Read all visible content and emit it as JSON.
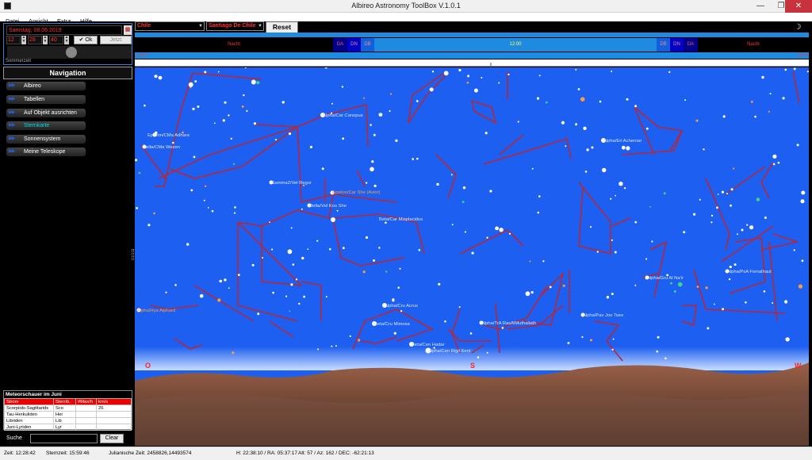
{
  "window": {
    "title": "Albireo Astronomy ToolBox V.1.0.1",
    "minimize": "—",
    "maximize": "❐",
    "close": "✕"
  },
  "menu": [
    "Datei",
    "Ansicht",
    "Extra",
    "Hilfe"
  ],
  "datetime": {
    "date": "Samstag, 08.06.2019",
    "hour": "12",
    "minute": "28",
    "second": "40",
    "ok_label": "✔ Ok",
    "now_label": "Jetzt",
    "dst_label": "Sommerzeit"
  },
  "location": {
    "country": "Chile",
    "city": "Santiago De Chile",
    "reset_label": "Reset"
  },
  "timeline": {
    "nacht_left": "Nacht",
    "da": "DA",
    "dn": "DN",
    "db": "DB",
    "noon": "12:00",
    "nacht_right": "Nacht",
    "scale_left": "19:54",
    "scale_right": "19:54"
  },
  "navigation": {
    "title": "Navigation",
    "items": [
      {
        "label": "Albireo",
        "active": false
      },
      {
        "label": "Tabellen",
        "active": false
      },
      {
        "label": "Auf Objekt ausrichten",
        "active": false
      },
      {
        "label": "Sternkarte",
        "active": true
      },
      {
        "label": "Sonnensystem",
        "active": false
      },
      {
        "label": "Meine Teleskope",
        "active": false
      }
    ]
  },
  "meteors": {
    "title": "Meteorschauer im Juni",
    "headers": [
      "Strom",
      "Sternb.",
      "#Max/h",
      "km/s"
    ],
    "rows": [
      [
        "Scorpiids-Sagittarids",
        "Sco",
        "",
        "26"
      ],
      [
        "Tau-Herkuliden",
        "Her",
        "",
        ""
      ],
      [
        "Libriden",
        "Lib",
        "",
        ""
      ],
      [
        "Juni-Lyriden",
        "Lyr",
        "",
        ""
      ]
    ]
  },
  "search": {
    "label": "Suche",
    "clear_label": "Clear"
  },
  "compass": {
    "east": "O",
    "south": "S",
    "west": "W"
  },
  "stars": [
    {
      "name": "Alpha/Car Canopus"
    },
    {
      "name": "Epsilon/CMa Adhara"
    },
    {
      "name": "Delta/CMa Wezen"
    },
    {
      "name": "Gamma2/Vel Regor"
    },
    {
      "name": "Epsilon/Car She (Avior)"
    },
    {
      "name": "Delta/Vel Koo She"
    },
    {
      "name": "Beta/Car Miaplacidus"
    },
    {
      "name": "Alpha/Eri Achernar"
    },
    {
      "name": "Alpha/Gru Al Na'ir"
    },
    {
      "name": "Alpha/PsA Fomalhaut"
    },
    {
      "name": "Alpha/Pav Joo Tseo"
    },
    {
      "name": "Alpha/TrA RasAlMuthallath"
    },
    {
      "name": "Alpha/Cru Acrux"
    },
    {
      "name": "Beta/Cru Mimosa"
    },
    {
      "name": "Beta/Cen Hadar"
    },
    {
      "name": "Alpha/Cen Rigil Kent"
    },
    {
      "name": "Alpha/Hya Alphard"
    }
  ],
  "status": {
    "zeit": "Zeit: 12:28:42",
    "sternzeit": "Sternzeit: 15:59:46",
    "julian": "Julianische Zeit: 2458826,14493574",
    "coords": "H: 22:38:10 / RA: 05:37:17",
    "altaz": "Alt: 57 / Az: 162 / DEC: -62:21:13"
  },
  "colors": {
    "sky": "#1d5ff0",
    "constellation_line": "#b4283c",
    "accent": "#1e8ae0",
    "alert_text": "#ff3333"
  }
}
